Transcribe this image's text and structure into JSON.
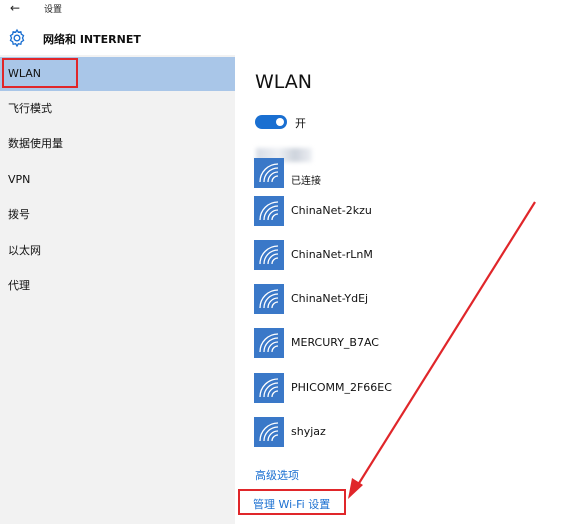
{
  "window": {
    "back_glyph": "←",
    "app_title": "设置"
  },
  "header": {
    "title": "网络和 INTERNET",
    "icon": "gear-icon"
  },
  "sidebar": {
    "items": [
      {
        "label": "WLAN",
        "selected": true
      },
      {
        "label": "飞行模式"
      },
      {
        "label": "数据使用量"
      },
      {
        "label": "VPN"
      },
      {
        "label": "拨号"
      },
      {
        "label": "以太网"
      },
      {
        "label": "代理"
      }
    ]
  },
  "main": {
    "title": "WLAN",
    "toggle_label": "开",
    "toggle_on": true,
    "connected_status": "已连接",
    "networks": [
      {
        "name": "ChinaNet-2kzu"
      },
      {
        "name": "ChinaNet-rLnM"
      },
      {
        "name": "ChinaNet-YdEj"
      },
      {
        "name": "MERCURY_B7AC"
      },
      {
        "name": "PHICOMM_2F66EC"
      },
      {
        "name": "shyjaz"
      }
    ],
    "advanced_link": "高级选项",
    "manage_link": "管理 Wi-Fi 设置"
  },
  "colors": {
    "accent": "#1a6fd1",
    "selected_bg": "#a9c6e8",
    "sidebar_bg": "#f2f2f2",
    "wifi_tile": "#3a78c8",
    "annotation_red": "#e0262a"
  }
}
